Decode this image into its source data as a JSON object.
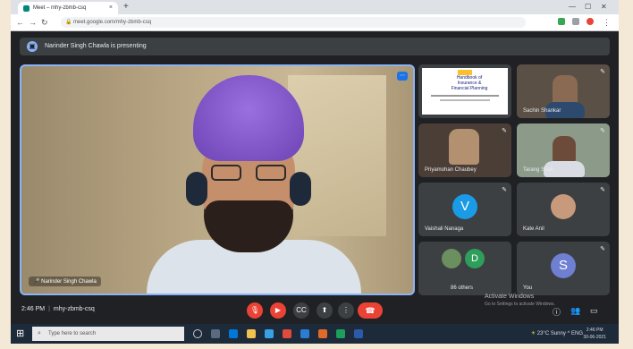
{
  "browser": {
    "tab_title": "Meet – mhy-zbmb-csq",
    "url": "meet.google.com/mhy-zbmb-csq",
    "new_tab": "+",
    "close_tab": "×"
  },
  "meet": {
    "presenting_banner": "Narinder Singh Chawla is presenting",
    "main_speaker_name": "Narinder Singh Chawla",
    "slide_title": "Handbook of Insurance & Financial Planning",
    "participants": [
      {
        "name": "Sachin Shankar"
      },
      {
        "name": "Priyamohan Chaubey"
      },
      {
        "name": "Tarang Shah"
      },
      {
        "name": "Vaishali Nanaga",
        "initial": "V",
        "color": "#1a9be6"
      },
      {
        "name": "Kate Anil"
      },
      {
        "name": "86 others",
        "initial": "D",
        "color": "#2e9e5b"
      },
      {
        "name": "You",
        "initial": "S",
        "color": "#6f7fd2"
      }
    ],
    "time": "2:46 PM",
    "separator": "|",
    "meeting_code": "mhy-zbmb-csq",
    "activate_title": "Activate Windows",
    "activate_sub": "Go to Settings to activate Windows."
  },
  "taskbar": {
    "search_placeholder": "Type here to search",
    "tray_text": "23°C Sunny  ^  ENG",
    "clock_time": "2:46 PM",
    "clock_date": "30-06-2021"
  }
}
